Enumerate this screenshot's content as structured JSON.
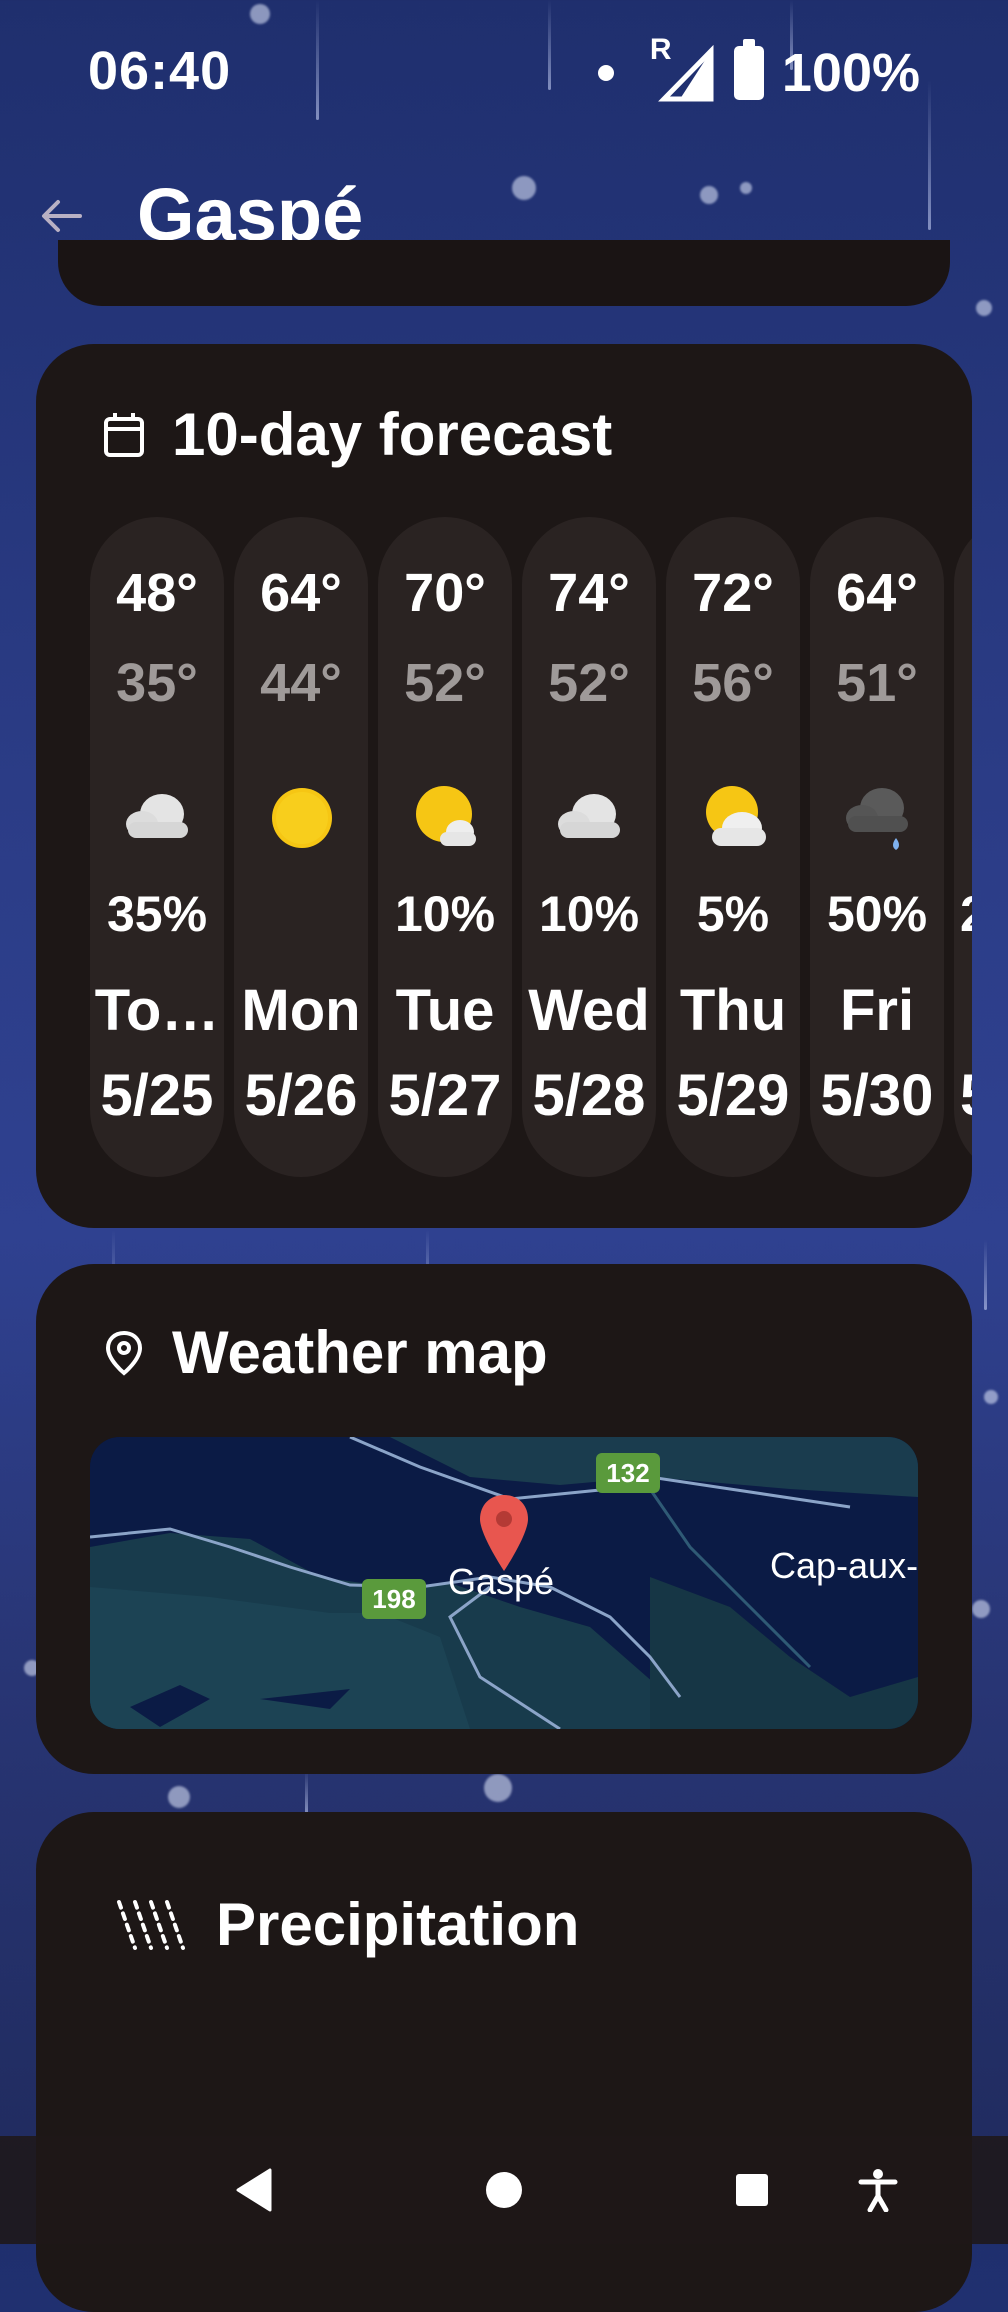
{
  "status": {
    "time": "06:40",
    "network_badge": "R",
    "battery": "100%"
  },
  "header": {
    "title": "Gaspé"
  },
  "forecast": {
    "title": "10-day forecast",
    "days": [
      {
        "hi": "48°",
        "lo": "35°",
        "icon": "cloudy-icon",
        "precip": "35%",
        "day": "To…",
        "date": "5/25"
      },
      {
        "hi": "64°",
        "lo": "44°",
        "icon": "sunny-icon",
        "precip": "",
        "day": "Mon",
        "date": "5/26"
      },
      {
        "hi": "70°",
        "lo": "52°",
        "icon": "mostly-sunny-icon",
        "precip": "10%",
        "day": "Tue",
        "date": "5/27"
      },
      {
        "hi": "74°",
        "lo": "52°",
        "icon": "cloudy-icon",
        "precip": "10%",
        "day": "Wed",
        "date": "5/28"
      },
      {
        "hi": "72°",
        "lo": "56°",
        "icon": "partly-cloudy-icon",
        "precip": "5%",
        "day": "Thu",
        "date": "5/29"
      },
      {
        "hi": "64°",
        "lo": "51°",
        "icon": "rain-icon",
        "precip": "50%",
        "day": "Fri",
        "date": "5/30"
      },
      {
        "hi": "",
        "lo": "",
        "icon": "",
        "precip": "2",
        "day": "",
        "date": "5"
      }
    ]
  },
  "map": {
    "title": "Weather map",
    "place_label": "Gaspé",
    "place_label_2": "Cap-aux-",
    "route_1": "132",
    "route_2": "198"
  },
  "precipitation": {
    "title": "Precipitation"
  },
  "colors": {
    "card": "#1d1716",
    "day_pill": "#2a2322",
    "sun": "#f6c614",
    "pin": "#e8564f",
    "route_badge": "#5a9a3c"
  }
}
